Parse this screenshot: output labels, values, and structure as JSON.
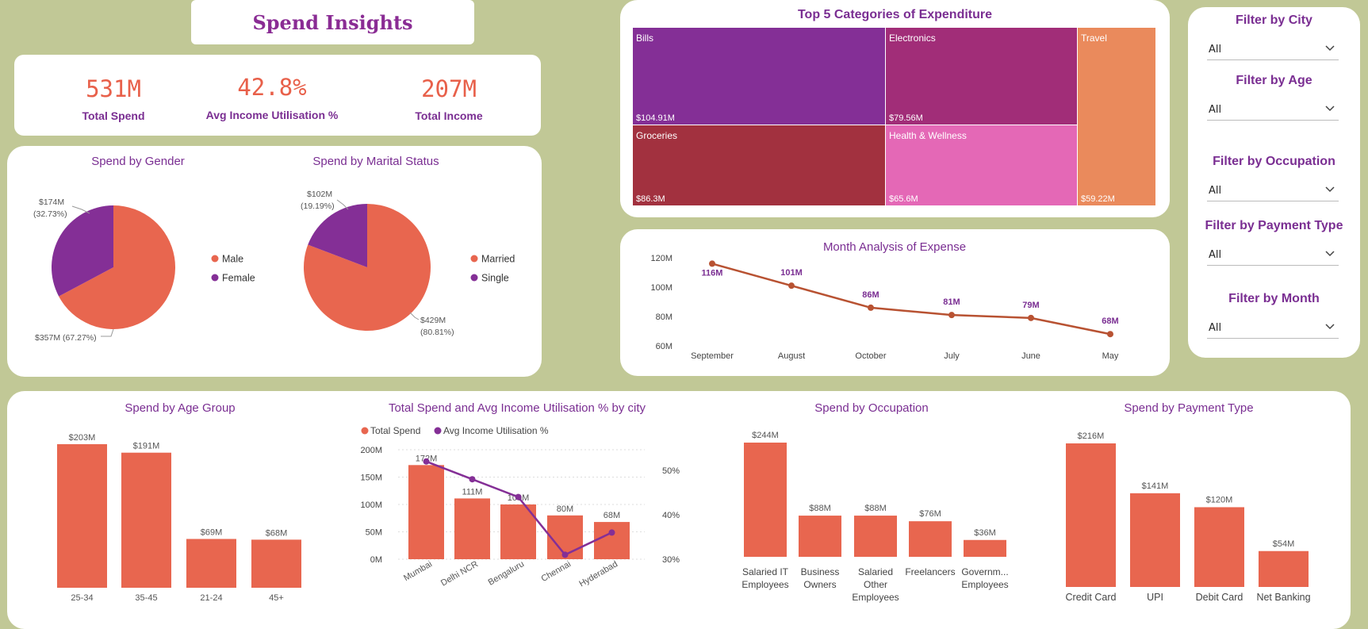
{
  "header": {
    "title": "Spend Insights"
  },
  "kpis": [
    {
      "value": "531M",
      "label": "Total Spend"
    },
    {
      "value": "42.8%",
      "label": "Avg Income Utilisation %"
    },
    {
      "value": "207M",
      "label": "Total Income"
    }
  ],
  "colors": {
    "primary": "#e8664f",
    "secondary": "#842f96",
    "line": "#b85232",
    "background": "#c1c896"
  },
  "gender": {
    "title": "Spend by Gender",
    "slices": [
      {
        "name": "Male",
        "value": 357,
        "label1": "$357M (67.27%)",
        "color": "#e8664f"
      },
      {
        "name": "Female",
        "value": 174,
        "label1": "$174M",
        "label2": "(32.73%)",
        "color": "#842f96"
      }
    ]
  },
  "marital": {
    "title": "Spend by Marital Status",
    "slices": [
      {
        "name": "Married",
        "value": 429,
        "label1": "$429M",
        "label2": "(80.81%)",
        "color": "#e8664f"
      },
      {
        "name": "Single",
        "value": 102,
        "label1": "$102M",
        "label2": "(19.19%)",
        "color": "#842f96"
      }
    ]
  },
  "treemap": {
    "title": "Top 5 Categories of Expenditure",
    "cells": [
      {
        "name": "Bills",
        "value": "$104.91M",
        "color": "#842f96"
      },
      {
        "name": "Electronics",
        "value": "$79.56M",
        "color": "#a12d78"
      },
      {
        "name": "Travel",
        "value": "$59.22M",
        "color": "#ea8a5c"
      },
      {
        "name": "Groceries",
        "value": "$86.3M",
        "color": "#a2313f"
      },
      {
        "name": "Health & Wellness",
        "value": "$65.6M",
        "color": "#e468b6"
      }
    ]
  },
  "month": {
    "title": "Month Analysis of Expense",
    "y_ticks": [
      "120M",
      "100M",
      "80M",
      "60M"
    ],
    "points": [
      {
        "month": "September",
        "value": 116,
        "label": "116M"
      },
      {
        "month": "August",
        "value": 101,
        "label": "101M"
      },
      {
        "month": "October",
        "value": 86,
        "label": "86M"
      },
      {
        "month": "July",
        "value": 81,
        "label": "81M"
      },
      {
        "month": "June",
        "value": 79,
        "label": "79M"
      },
      {
        "month": "May",
        "value": 68,
        "label": "68M"
      }
    ]
  },
  "filters": [
    {
      "label": "Filter by City",
      "value": "All"
    },
    {
      "label": "Filter by Age",
      "value": "All"
    },
    {
      "label": "Filter by Occupation",
      "value": "All"
    },
    {
      "label": "Filter by Payment Type",
      "value": "All"
    },
    {
      "label": "Filter by Month",
      "value": "All"
    }
  ],
  "age": {
    "title": "Spend by Age Group",
    "bars": [
      {
        "category": "25-34",
        "value": 203,
        "label": "$203M"
      },
      {
        "category": "35-45",
        "value": 191,
        "label": "$191M"
      },
      {
        "category": "21-24",
        "value": 69,
        "label": "$69M"
      },
      {
        "category": "45+",
        "value": 68,
        "label": "$68M"
      }
    ]
  },
  "city": {
    "title": "Total Spend and Avg Income Utilisation % by city",
    "legend": [
      "Total Spend",
      "Avg Income Utilisation %"
    ],
    "y_left_ticks": [
      "200M",
      "150M",
      "100M",
      "50M",
      "0M"
    ],
    "y_right_ticks": [
      "50%",
      "40%",
      "30%"
    ],
    "bars": [
      {
        "city": "Mumbai",
        "spend": 172,
        "label": "172M",
        "util": 52
      },
      {
        "city": "Delhi NCR",
        "spend": 111,
        "label": "111M",
        "util": 48
      },
      {
        "city": "Bengaluru",
        "spend": 100,
        "label": "100M",
        "util": 44
      },
      {
        "city": "Chennai",
        "spend": 80,
        "label": "80M",
        "util": 31
      },
      {
        "city": "Hyderabad",
        "spend": 68,
        "label": "68M",
        "util": 36
      }
    ]
  },
  "occupation": {
    "title": "Spend by Occupation",
    "bars": [
      {
        "category": [
          "Salaried IT",
          "Employees"
        ],
        "value": 244,
        "label": "$244M"
      },
      {
        "category": [
          "Business",
          "Owners"
        ],
        "value": 88,
        "label": "$88M"
      },
      {
        "category": [
          "Salaried",
          "Other",
          "Employees"
        ],
        "value": 88,
        "label": "$88M"
      },
      {
        "category": [
          "Freelancers"
        ],
        "value": 76,
        "label": "$76M"
      },
      {
        "category": [
          "Governm...",
          "Employees"
        ],
        "value": 36,
        "label": "$36M"
      }
    ]
  },
  "payment": {
    "title": "Spend by Payment Type",
    "bars": [
      {
        "category": "Credit Card",
        "value": 216,
        "label": "$216M"
      },
      {
        "category": "UPI",
        "value": 141,
        "label": "$141M"
      },
      {
        "category": "Debit Card",
        "value": 120,
        "label": "$120M"
      },
      {
        "category": "Net Banking",
        "value": 54,
        "label": "$54M"
      }
    ]
  },
  "chart_data": [
    {
      "type": "pie",
      "title": "Spend by Gender",
      "labels": [
        "Male",
        "Female"
      ],
      "values": [
        357,
        174
      ]
    },
    {
      "type": "pie",
      "title": "Spend by Marital Status",
      "labels": [
        "Married",
        "Single"
      ],
      "values": [
        429,
        102
      ]
    },
    {
      "type": "bar",
      "title": "Top 5 Categories of Expenditure",
      "categories": [
        "Bills",
        "Groceries",
        "Electronics",
        "Health & Wellness",
        "Travel"
      ],
      "values": [
        104.91,
        86.3,
        79.56,
        65.6,
        59.22
      ]
    },
    {
      "type": "line",
      "title": "Month Analysis of Expense",
      "x": [
        "September",
        "August",
        "October",
        "July",
        "June",
        "May"
      ],
      "values": [
        116,
        101,
        86,
        81,
        79,
        68
      ],
      "ylim": [
        60,
        120
      ]
    },
    {
      "type": "bar",
      "title": "Spend by Age Group",
      "categories": [
        "25-34",
        "35-45",
        "21-24",
        "45+"
      ],
      "values": [
        203,
        191,
        69,
        68
      ]
    },
    {
      "type": "bar",
      "title": "Total Spend and Avg Income Utilisation % by city",
      "categories": [
        "Mumbai",
        "Delhi NCR",
        "Bengaluru",
        "Chennai",
        "Hyderabad"
      ],
      "series": [
        {
          "name": "Total Spend",
          "values": [
            172,
            111,
            100,
            80,
            68
          ]
        },
        {
          "name": "Avg Income Utilisation %",
          "values": [
            52,
            48,
            44,
            31,
            36
          ]
        }
      ]
    },
    {
      "type": "bar",
      "title": "Spend by Occupation",
      "categories": [
        "Salaried IT Employees",
        "Business Owners",
        "Salaried Other Employees",
        "Freelancers",
        "Governm... Employees"
      ],
      "values": [
        244,
        88,
        88,
        76,
        36
      ]
    },
    {
      "type": "bar",
      "title": "Spend by Payment Type",
      "categories": [
        "Credit Card",
        "UPI",
        "Debit Card",
        "Net Banking"
      ],
      "values": [
        216,
        141,
        120,
        54
      ]
    }
  ]
}
